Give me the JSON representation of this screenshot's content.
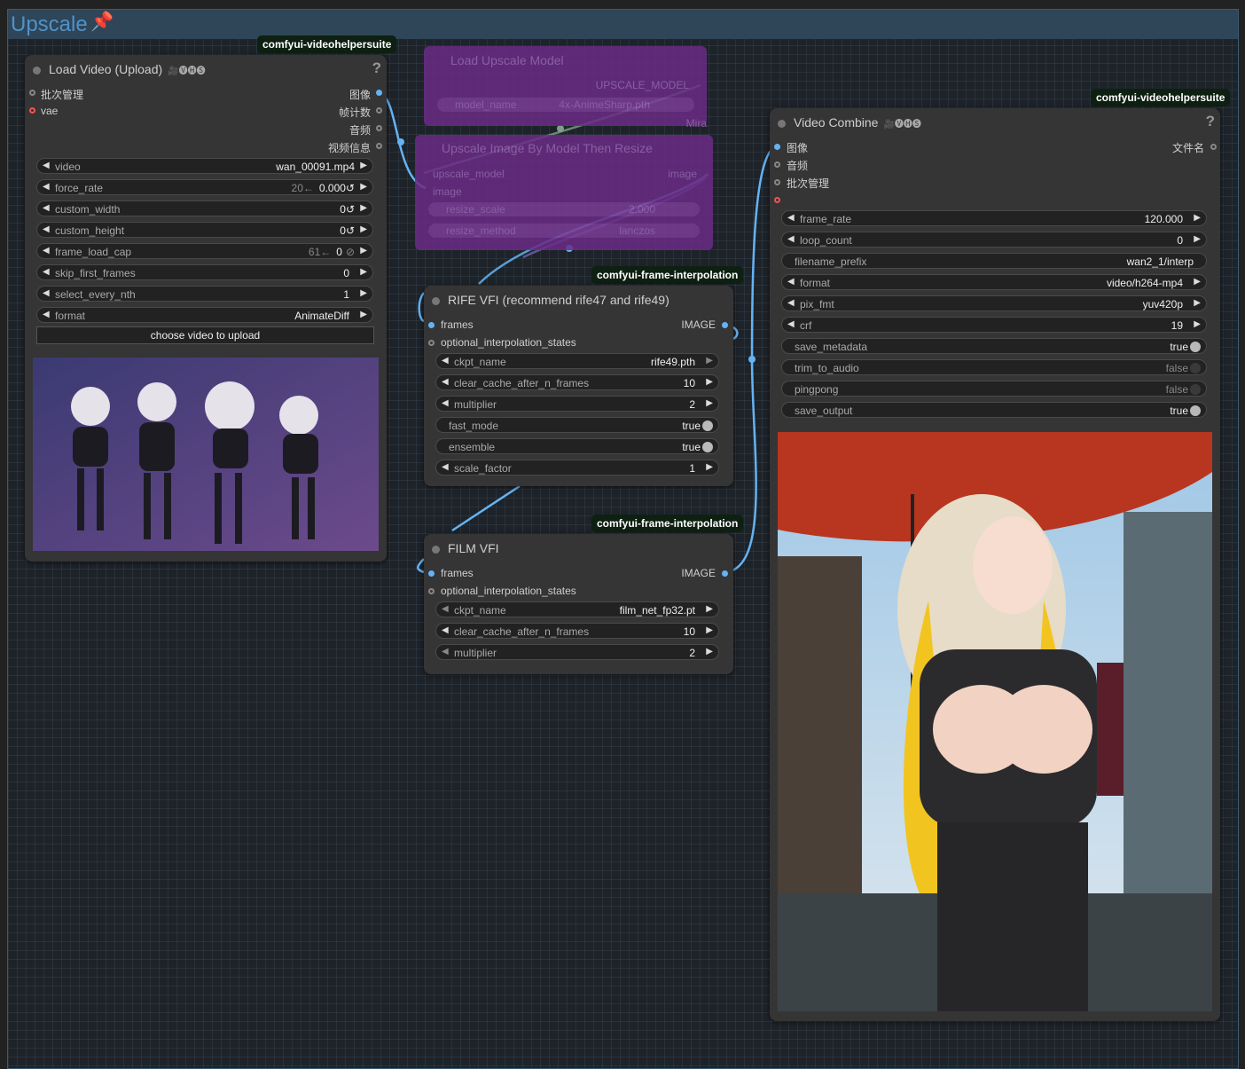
{
  "group": {
    "title": "Upscale",
    "pin_icon": "📌"
  },
  "badges": {
    "load_video": "comfyui-videohelpersuite",
    "video_combine": "comfyui-videohelpersuite",
    "rife": "comfyui-frame-interpolation",
    "film": "comfyui-frame-interpolation"
  },
  "load_video": {
    "title": "Load Video (Upload)",
    "vhs_label": "🎥🅥🅗🅢",
    "help": "?",
    "inputs": [
      "批次管理",
      "vae"
    ],
    "outputs": [
      "图像",
      "帧计数",
      "音频",
      "视频信息"
    ],
    "widgets": [
      {
        "name": "video",
        "value": "wan_00091.mp4",
        "extra": ""
      },
      {
        "name": "force_rate",
        "value": "0.000↺",
        "extra": "20←"
      },
      {
        "name": "custom_width",
        "value": "0↺",
        "extra": ""
      },
      {
        "name": "custom_height",
        "value": "0↺",
        "extra": ""
      },
      {
        "name": "frame_load_cap",
        "value": "0",
        "extra": "61←"
      },
      {
        "name": "skip_first_frames",
        "value": "0",
        "extra": ""
      },
      {
        "name": "select_every_nth",
        "value": "1",
        "extra": ""
      },
      {
        "name": "format",
        "value": "AnimateDiff",
        "extra": ""
      }
    ],
    "upload_label": "choose video to upload"
  },
  "load_upscale": {
    "title": "Load Upscale Model",
    "output": "UPSCALE_MODEL",
    "widget_name": "model_name",
    "widget_value": "4x-AnimeSharp.pth",
    "footer": "Mira"
  },
  "upscale_resize": {
    "title": "Upscale Image By Model Then Resize",
    "inputs": [
      "upscale_model",
      "image"
    ],
    "output": "image",
    "widgets": [
      {
        "name": "resize_scale",
        "value": "2.000"
      },
      {
        "name": "resize_method",
        "value": "lanczos"
      }
    ]
  },
  "rife": {
    "title": "RIFE VFI (recommend rife47 and rife49)",
    "inputs": [
      "frames",
      "optional_interpolation_states"
    ],
    "output": "IMAGE",
    "widgets": [
      {
        "name": "ckpt_name",
        "value": "rife49.pth"
      },
      {
        "name": "clear_cache_after_n_frames",
        "value": "10"
      },
      {
        "name": "multiplier",
        "value": "2"
      },
      {
        "name": "fast_mode",
        "value": "true"
      },
      {
        "name": "ensemble",
        "value": "true"
      },
      {
        "name": "scale_factor",
        "value": "1"
      }
    ]
  },
  "film": {
    "title": "FILM VFI",
    "inputs": [
      "frames",
      "optional_interpolation_states"
    ],
    "output": "IMAGE",
    "widgets": [
      {
        "name": "ckpt_name",
        "value": "film_net_fp32.pt"
      },
      {
        "name": "clear_cache_after_n_frames",
        "value": "10"
      },
      {
        "name": "multiplier",
        "value": "2"
      }
    ]
  },
  "video_combine": {
    "title": "Video Combine",
    "vhs_label": "🎥🅥🅗🅢",
    "help": "?",
    "inputs": [
      "图像",
      "音频",
      "批次管理"
    ],
    "output": "文件名",
    "widgets": [
      {
        "name": "frame_rate",
        "value": "120.000"
      },
      {
        "name": "loop_count",
        "value": "0"
      },
      {
        "name": "filename_prefix",
        "value": "wan2_1/interp"
      },
      {
        "name": "format",
        "value": "video/h264-mp4"
      },
      {
        "name": "pix_fmt",
        "value": "yuv420p"
      },
      {
        "name": "crf",
        "value": "19"
      },
      {
        "name": "save_metadata",
        "value": "true"
      },
      {
        "name": "trim_to_audio",
        "value": "false"
      },
      {
        "name": "pingpong",
        "value": "false"
      },
      {
        "name": "save_output",
        "value": "true"
      }
    ]
  },
  "colors": {
    "canvas": "#1d2329",
    "group_header": "#2f4558",
    "node": "#353535",
    "link_image": "#65b3f3",
    "link_upscale": "#7f9f8a",
    "ghost_node": "#6a2c86",
    "badge": "#0e2012"
  }
}
